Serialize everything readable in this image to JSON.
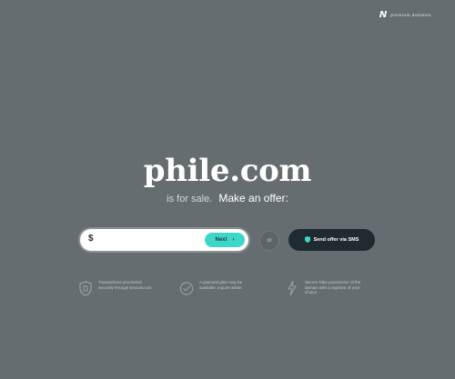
{
  "header": {
    "logo_mark": "N",
    "brand_label": "premium.domains"
  },
  "hero": {
    "domain": "phile.com",
    "tagline_prefix": "is for sale.",
    "tagline_cta": "Make an offer:"
  },
  "offer_form": {
    "currency_symbol": "$",
    "amount_placeholder": "",
    "next_label": "Next",
    "next_arrow": "›",
    "or_label": "or",
    "sms_label": "Send offer via SMS",
    "sms_icon": "shield-icon"
  },
  "features": [
    {
      "icon": "shield-icon",
      "text": "Transactions processed securely through Escrow.com"
    },
    {
      "icon": "check-circle-icon",
      "text": "A payment plan may be available, inquire within"
    },
    {
      "icon": "lightning-icon",
      "text": "Secure Take possession of the domain with a registrar of your choice"
    }
  ],
  "colors": {
    "background": "#666d71",
    "accent": "#3ed6c6",
    "dark_button": "#1f2a31"
  }
}
